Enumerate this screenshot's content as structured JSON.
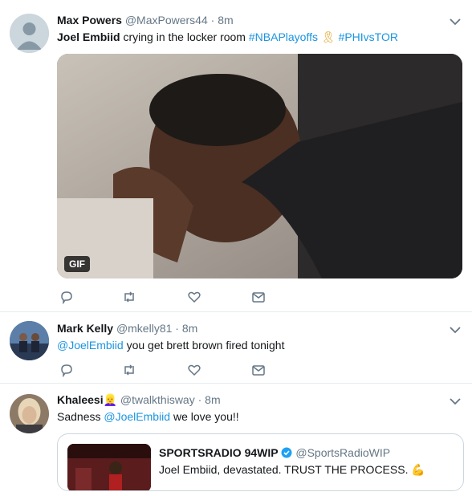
{
  "tweets": [
    {
      "name": "Max Powers",
      "handle": "@MaxPowers44",
      "sep": "·",
      "time": "8m",
      "text_plain": "Joel Embiid",
      "text_rest": " crying in the locker room ",
      "hashtag1": "#NBAPlayoffs",
      "emoji": "🎗",
      "hashtag2": "#PHIvsTOR",
      "media_badge": "GIF"
    },
    {
      "name": "Mark Kelly",
      "handle": "@mkelly81",
      "sep": "·",
      "time": "8m",
      "mention": "@JoelEmbiid",
      "text_rest": " you get brett brown fired tonight"
    },
    {
      "name": "Khaleesi",
      "name_emoji": "👱‍♀️",
      "handle": "@twalkthisway",
      "sep": "·",
      "time": "8m",
      "text_pre": "Sadness ",
      "mention": "@JoelEmbiid",
      "text_rest": " we love you!!"
    }
  ],
  "quote": {
    "name": "SPORTSRADIO 94WIP",
    "handle": "@SportsRadioWIP",
    "text": "Joel Embiid, devastated. TRUST THE PROCESS. ",
    "emoji": "💪"
  },
  "icons": [
    "reply-icon",
    "retweet-icon",
    "like-icon",
    "direct-message-icon",
    "chevron-down-icon",
    "verified-icon",
    "default-avatar-icon"
  ],
  "colors": {
    "link": "#1b95e0",
    "muted": "#657786",
    "border": "#e6ecf0"
  }
}
